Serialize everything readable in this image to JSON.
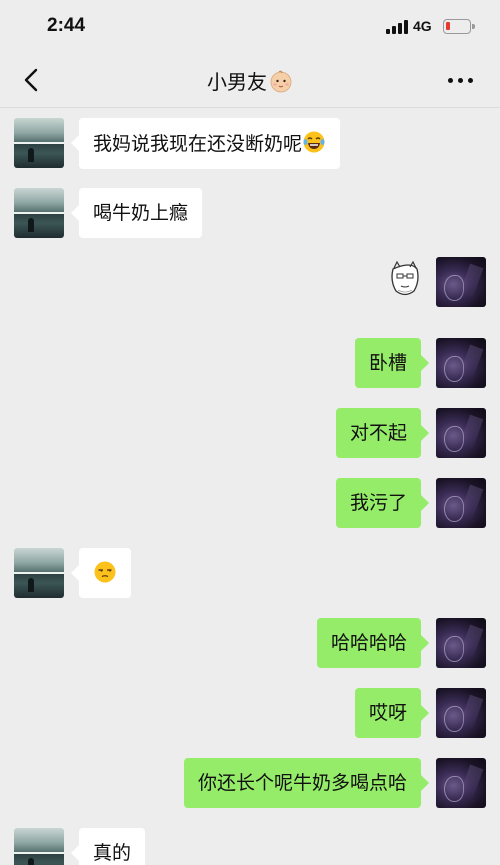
{
  "status": {
    "time": "2:44",
    "network": "4G",
    "battery_color": "#e53935"
  },
  "header": {
    "title": "小男友",
    "title_emoji": "baby-face-icon",
    "back_icon": "chevron-left-icon",
    "more_icon": "more-dots-icon"
  },
  "colors": {
    "background": "#ededed",
    "sent_bubble": "#95ec69",
    "received_bubble": "#ffffff"
  },
  "messages": [
    {
      "side": "left",
      "text": "我妈说我现在还没断奶呢",
      "emoji": "laughing-tears-icon"
    },
    {
      "side": "left",
      "text": "喝牛奶上瘾"
    },
    {
      "side": "right",
      "sticker": "face-sticker-icon"
    },
    {
      "side": "right",
      "text": "卧槽"
    },
    {
      "side": "right",
      "text": "对不起"
    },
    {
      "side": "right",
      "text": "我污了"
    },
    {
      "side": "left",
      "emoji": "unamused-face-icon"
    },
    {
      "side": "right",
      "text": "哈哈哈哈"
    },
    {
      "side": "right",
      "text": "哎呀"
    },
    {
      "side": "right",
      "text": "你还长个呢牛奶多喝点哈"
    },
    {
      "side": "left",
      "text": "真的"
    }
  ]
}
